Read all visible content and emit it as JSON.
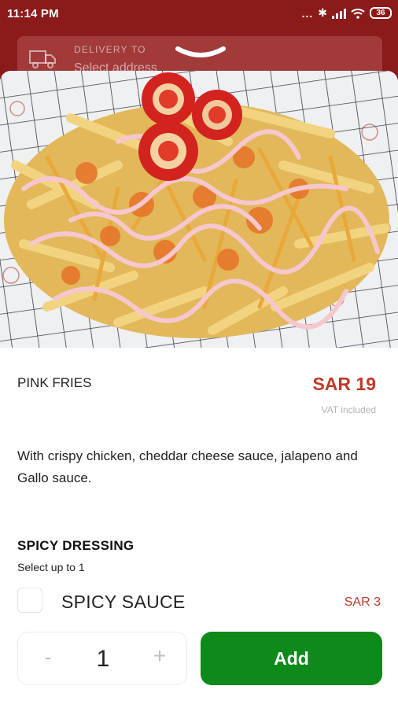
{
  "status_bar": {
    "time": "11:14 PM",
    "dots": "...",
    "battery": "36"
  },
  "delivery": {
    "label": "DELIVERY TO",
    "address_placeholder": "Select address",
    "icon": "truck-icon"
  },
  "product": {
    "name": "PINK FRIES",
    "price": "SAR 19",
    "vat_note": "VAT included",
    "description": "With crispy chicken, cheddar cheese sauce, jalapeno and Gallo sauce."
  },
  "options": {
    "title": "SPICY DRESSING",
    "subtitle": "Select up to 1",
    "items": [
      {
        "label": "SPICY SAUCE",
        "price": "SAR 3",
        "checked": false
      }
    ]
  },
  "cart": {
    "minus": "-",
    "quantity": "1",
    "plus": "+",
    "add_label": "Add"
  },
  "colors": {
    "brand": "#8b1a1a",
    "price": "#c0392b",
    "add_button": "#0f8a1a"
  }
}
